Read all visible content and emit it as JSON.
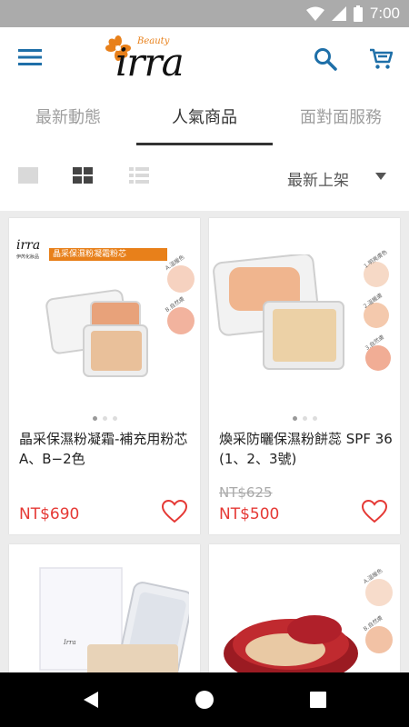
{
  "status_bar": {
    "time": "7:00"
  },
  "logo": {
    "small": "Beauty",
    "big": "irra"
  },
  "tabs": [
    {
      "label": "最新動態"
    },
    {
      "label": "人氣商品"
    },
    {
      "label": "面對面服務"
    }
  ],
  "active_tab": "人氣商品",
  "toolbar": {
    "sort_label": "最新上架"
  },
  "products": [
    {
      "name": "晶采保濕粉凝霜-補充用粉芯A、B−2色",
      "price": "NT$690",
      "original_price": "",
      "banner_brand": "irra",
      "banner_sub": "伊芮化妝品",
      "banner_title": "晶采保濕粉凝霜粉芯",
      "swatch_labels": [
        "A.溫暖色",
        "B.自然膚"
      ]
    },
    {
      "name": "煥采防曬保濕粉餅蕊 SPF 36 (1、2、3號)",
      "price": "NT$500",
      "original_price": "NT$625",
      "swatch_labels": [
        "1.明亮膚色",
        "2.溫暖膚",
        "3.自然膚"
      ]
    },
    {
      "name": "",
      "price": "",
      "original_price": "",
      "box_text": "Irra"
    },
    {
      "name": "",
      "price": "",
      "original_price": "",
      "swatch_labels": [
        "A.溫暖色",
        "B.自然膚"
      ]
    }
  ],
  "colors": {
    "accent": "#1e6fa8",
    "price": "#e53935",
    "logo_flower": "#e8801a"
  }
}
